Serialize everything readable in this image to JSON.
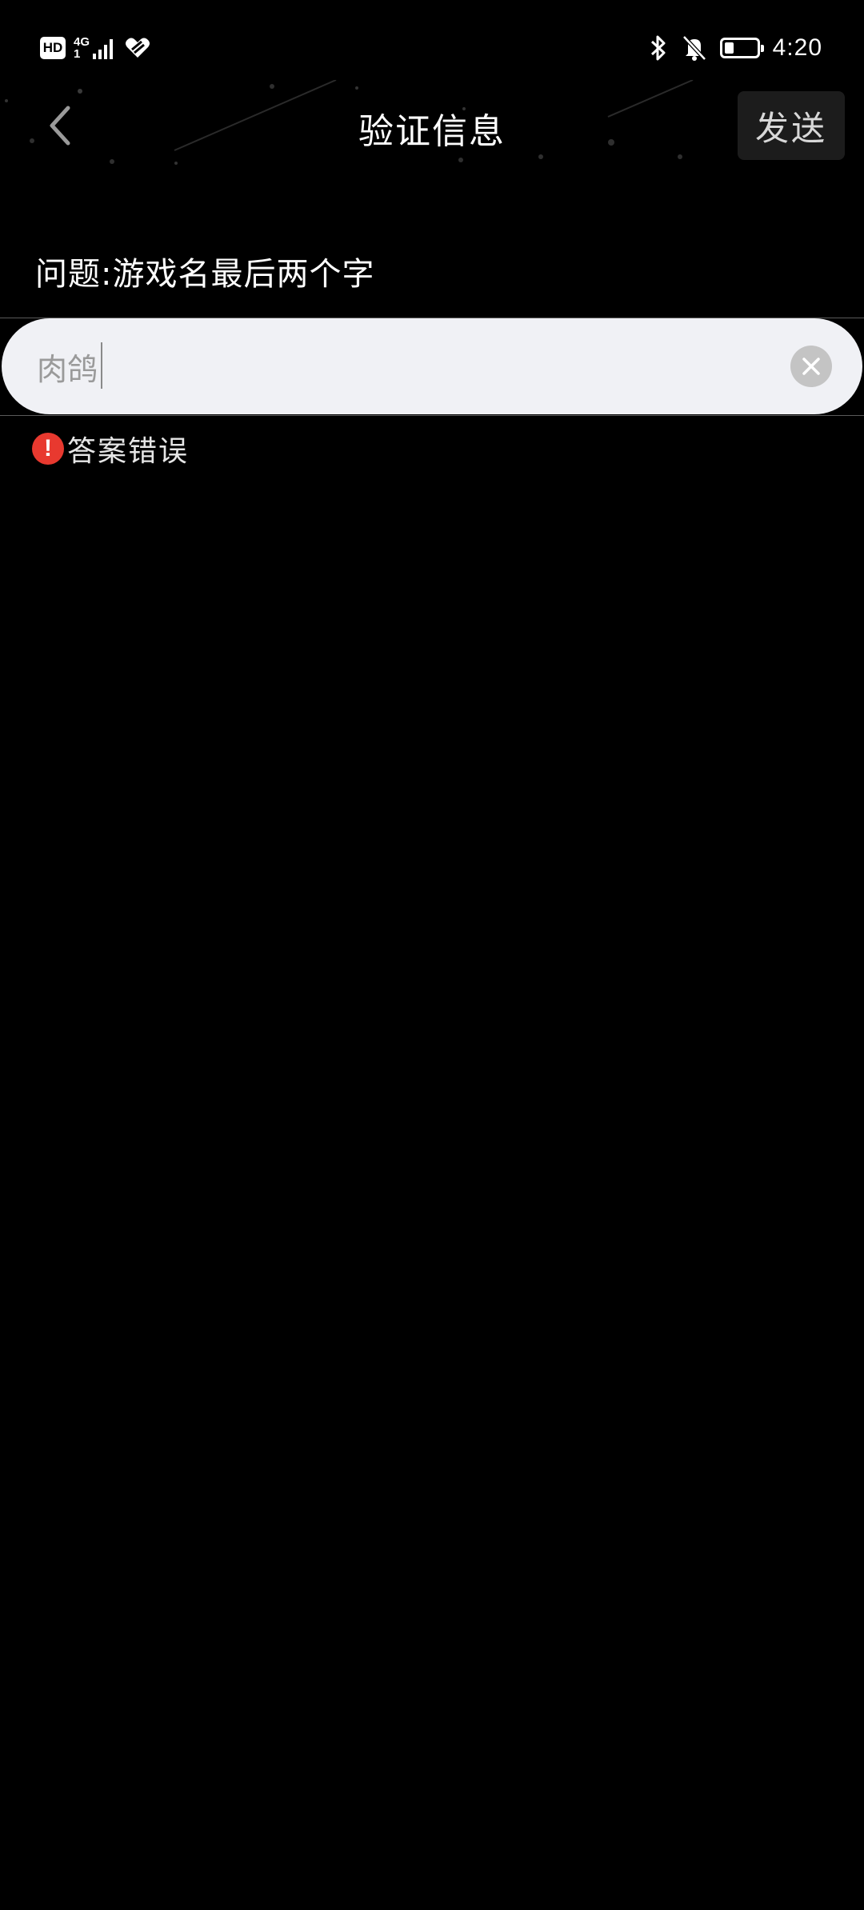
{
  "status_bar": {
    "hd_label": "HD",
    "network_label": "4G",
    "sim_slot": "1",
    "time": "4:20",
    "icons": [
      "signal-bars-icon",
      "wifi-heart-icon",
      "bluetooth-icon",
      "bell-muted-icon",
      "battery-icon"
    ],
    "battery_level": 0.3
  },
  "header": {
    "title": "验证信息",
    "send_label": "发送",
    "back_icon": "chevron-left-icon"
  },
  "question": {
    "text": "问题:游戏名最后两个字"
  },
  "answer": {
    "value": "肉鸽",
    "clear_icon": "close-icon"
  },
  "error": {
    "icon": "exclamation-icon",
    "symbol": "!",
    "text": "答案错误"
  },
  "colors": {
    "background": "#000000",
    "input_bg": "#f0f1f5",
    "error": "#e8392f",
    "send_button_bg": "#1c1c1c"
  }
}
